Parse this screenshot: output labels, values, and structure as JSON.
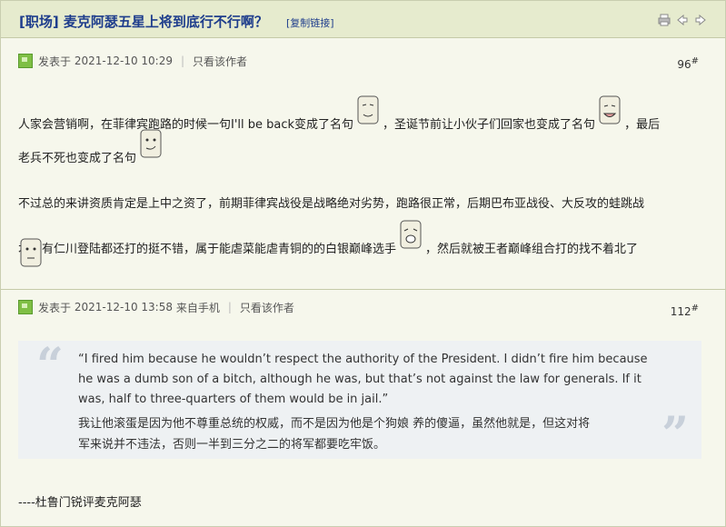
{
  "thread": {
    "title": "[职场] 麦克阿瑟五星上将到底行不行啊？",
    "copy_link": "[复制链接]"
  },
  "posts": [
    {
      "posted_prefix": "发表于",
      "time": "2021-12-10 10:29",
      "only_author": "只看该作者",
      "floor": "96",
      "floor_mark": "#",
      "lines": [
        {
          "segments": [
            "人家会营销啊，在菲律宾跑路的时候一句I'll be back变成了名句",
            "，圣诞节前让小伙子们回家也变成了名句",
            "，最后"
          ]
        },
        {
          "segments": [
            "老兵不死也变成了名句"
          ]
        },
        {
          "segments": [
            "不过总的来讲资质肯定是上中之资了，前期菲律宾战役是战略绝对劣势，跑路很正常，后期巴布亚战役、大反攻的蛙跳战"
          ]
        },
        {
          "segments": [
            "术还有仁川登陆都还打的挺不错，属于能虐菜能虐青铜的的白银巅峰选手",
            "，然后就被王者巅峰组合打的找不着北了"
          ]
        }
      ]
    },
    {
      "posted_prefix": "发表于",
      "time": "2021-12-10 13:58",
      "source": "来自手机",
      "only_author": "只看该作者",
      "floor": "112",
      "floor_mark": "#",
      "quote_lines": [
        "“I fired him because he wouldn’t respect the authority of the President. I didn’t fire him because",
        "he was a dumb son of a bitch, although he was, but that’s not against the law for generals. If it",
        "was, half to three-quarters of them would be in jail.”",
        "我让他滚蛋是因为他不尊重总统的权威，而不是因为他是个狗娘 养的傻逼，虽然他就是，但这对将",
        "军来说并不违法，否则一半到三分之二的将军都要吃牢饭。"
      ],
      "signature": "----杜鲁门锐评麦克阿瑟"
    }
  ]
}
